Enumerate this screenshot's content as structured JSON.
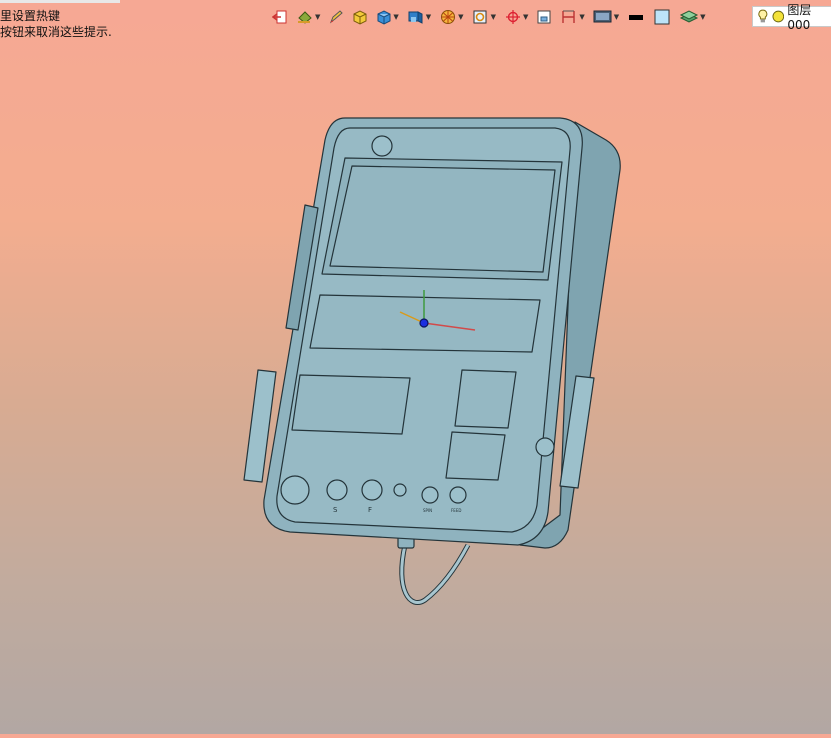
{
  "hint": {
    "line1": "里设置热键",
    "line2": "按钮来取消这些提示."
  },
  "toolbar": {
    "items": [
      {
        "icon": "exit-icon"
      },
      {
        "icon": "paint-bucket-icon",
        "dropdown": true
      },
      {
        "icon": "pencil-icon"
      },
      {
        "icon": "solid-box-icon"
      },
      {
        "icon": "shaded-cube-icon",
        "dropdown": true
      },
      {
        "icon": "view-cube-icon",
        "dropdown": true
      },
      {
        "icon": "render-sphere-icon",
        "dropdown": true
      },
      {
        "icon": "zoom-fit-icon",
        "dropdown": true
      },
      {
        "icon": "crosshair-icon",
        "dropdown": true
      },
      {
        "icon": "section-box-icon"
      },
      {
        "icon": "dimension-icon",
        "dropdown": true
      },
      {
        "icon": "monitor-icon",
        "dropdown": true
      },
      {
        "icon": "line-color-icon"
      },
      {
        "icon": "fill-color-icon"
      },
      {
        "icon": "layers-icon",
        "dropdown": true
      }
    ]
  },
  "layer": {
    "name": "图层000"
  },
  "model": {
    "labels": [
      "S",
      "F",
      "SPIN",
      "FEED"
    ]
  },
  "colors": {
    "model_fill": "#8fb3bf",
    "model_stroke": "#24343a",
    "bg_top": "#f6a894",
    "bg_bottom": "#b2a7a3"
  }
}
